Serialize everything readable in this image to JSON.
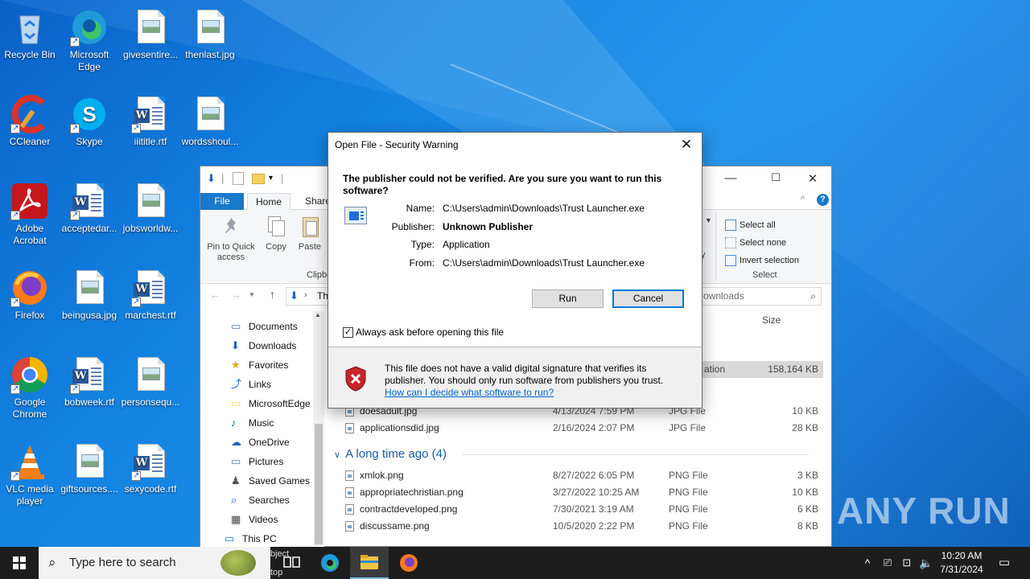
{
  "desktop": {
    "icons": [
      {
        "label": "Recycle Bin"
      },
      {
        "label": "Microsoft Edge"
      },
      {
        "label": "givesentire..."
      },
      {
        "label": "thenlast.jpg"
      },
      {
        "label": "CCleaner"
      },
      {
        "label": "Skype"
      },
      {
        "label": "iiititle.rtf"
      },
      {
        "label": "wordsshoul..."
      },
      {
        "label": "Adobe Acrobat"
      },
      {
        "label": "acceptedar..."
      },
      {
        "label": "jobsworldw..."
      },
      {
        "label": "Firefox"
      },
      {
        "label": "beingusa.jpg"
      },
      {
        "label": "marchest.rtf"
      },
      {
        "label": "Google Chrome"
      },
      {
        "label": "bobweek.rtf"
      },
      {
        "label": "personsequ..."
      },
      {
        "label": "VLC media player"
      },
      {
        "label": "giftsources...."
      },
      {
        "label": "sexycode.rtf"
      }
    ]
  },
  "explorer": {
    "tabs": {
      "file": "File",
      "home": "Home",
      "share": "Share"
    },
    "ribbon": {
      "pin": "Pin to Quick access",
      "copy": "Copy",
      "paste": "Paste",
      "clipboard_group": "Clipboard",
      "select_all": "Select all",
      "select_none": "Select none",
      "invert_selection": "Invert selection",
      "select_group": "Select",
      "partial_y": "y"
    },
    "address_partial": "Th",
    "search_placeholder": "ownloads",
    "column_size": "Size",
    "nav": [
      {
        "label": "Documents"
      },
      {
        "label": "Downloads"
      },
      {
        "label": "Favorites"
      },
      {
        "label": "Links"
      },
      {
        "label": "MicrosoftEdge"
      },
      {
        "label": "Music"
      },
      {
        "label": "OneDrive"
      },
      {
        "label": "Pictures"
      },
      {
        "label": "Saved Games"
      },
      {
        "label": "Searches"
      },
      {
        "label": "Videos"
      },
      {
        "label": "This PC"
      }
    ],
    "highlighted_row": {
      "type_partial": "ation",
      "size": "158,164 KB"
    },
    "rows_recent": [
      {
        "name": "doesadult.jpg",
        "date": "4/13/2024 7:59 PM",
        "type": "JPG File",
        "size": "10 KB"
      },
      {
        "name": "applicationsdid.jpg",
        "date": "2/16/2024 2:07 PM",
        "type": "JPG File",
        "size": "28 KB"
      }
    ],
    "group_old": "A long time ago (4)",
    "rows_old": [
      {
        "name": "xmlok.png",
        "date": "8/27/2022 6:05 PM",
        "type": "PNG File",
        "size": "3 KB"
      },
      {
        "name": "appropriatechristian.png",
        "date": "3/27/2022 10:25 AM",
        "type": "PNG File",
        "size": "10 KB"
      },
      {
        "name": "contractdeveloped.png",
        "date": "7/30/2021 3:19 AM",
        "type": "PNG File",
        "size": "6 KB"
      },
      {
        "name": "discussame.png",
        "date": "10/5/2020 2:22 PM",
        "type": "PNG File",
        "size": "8 KB"
      }
    ]
  },
  "dialog": {
    "title": "Open File - Security Warning",
    "heading": "The publisher could not be verified.  Are you sure you want to run this software?",
    "fields": [
      {
        "key": "Name:",
        "value": "C:\\Users\\admin\\Downloads\\Trust Launcher.exe"
      },
      {
        "key": "Publisher:",
        "value": "Unknown Publisher"
      },
      {
        "key": "Type:",
        "value": "Application"
      },
      {
        "key": "From:",
        "value": "C:\\Users\\admin\\Downloads\\Trust Launcher.exe"
      }
    ],
    "run": "Run",
    "cancel": "Cancel",
    "checkbox": "Always ask before opening this file",
    "checked": true,
    "footer_text": "This file does not have a valid digital signature that verifies its publisher.  You should only run software from publishers you trust.",
    "footer_link": "How can I decide what software to run?"
  },
  "taskbar": {
    "search_placeholder": "Type here to search",
    "partial_object": "bject",
    "partial_top": "top",
    "time": "10:20 AM",
    "date": "7/31/2024"
  },
  "watermark": "ANY RUN"
}
